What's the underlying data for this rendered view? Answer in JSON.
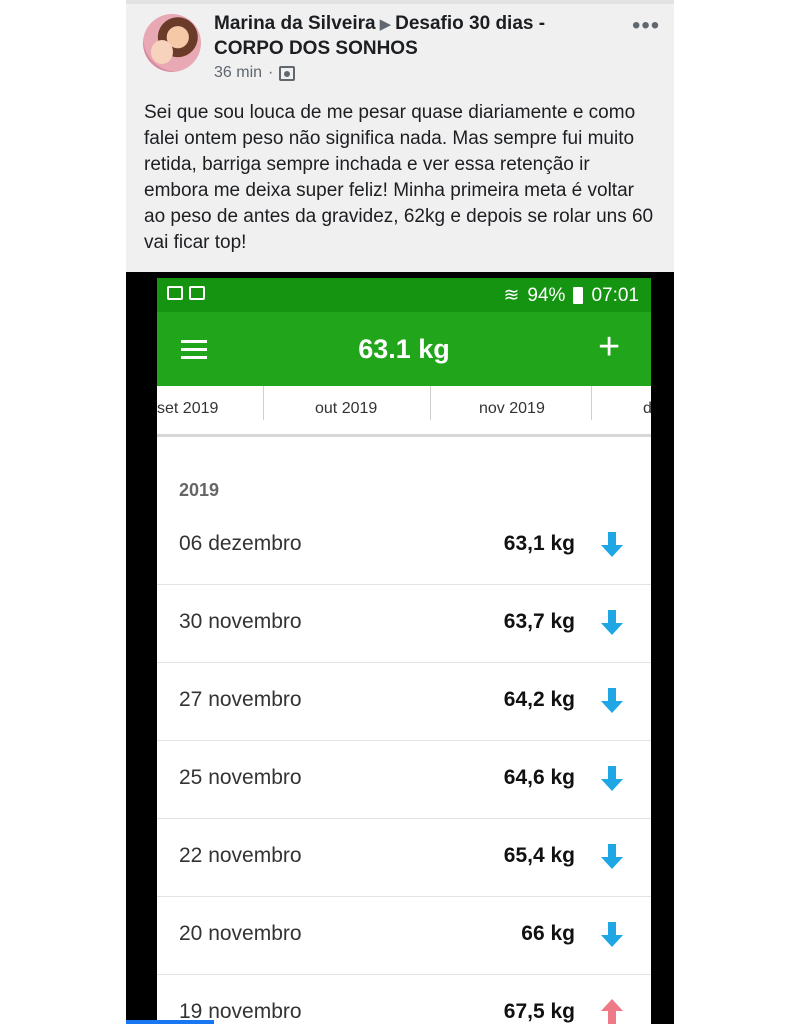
{
  "post": {
    "author": "Marina da Silveira",
    "group": "Desafio 30 dias - CORPO DOS SONHOS",
    "time": "36 min",
    "separator": "·",
    "more_label": "•••",
    "text": "Sei que sou louca de me pesar quase diariamente e como falei ontem peso não significa nada. Mas sempre fui muito retida, barriga sempre inchada e ver essa retenção ir embora me deixa super feliz! Minha primeira meta é voltar ao peso de antes da gravidez, 62kg e depois se rolar uns 60 vai ficar top!"
  },
  "phone": {
    "status": {
      "battery": "94%",
      "time": "07:01"
    },
    "appbar": {
      "title": "63.1 kg",
      "add_label": "+"
    },
    "tabs": [
      "set 2019",
      "out 2019",
      "nov 2019",
      "d"
    ],
    "year": "2019",
    "entries": [
      {
        "date": "06 dezembro",
        "weight": "63,1 kg",
        "trend": "down"
      },
      {
        "date": "30 novembro",
        "weight": "63,7 kg",
        "trend": "down"
      },
      {
        "date": "27 novembro",
        "weight": "64,2 kg",
        "trend": "down"
      },
      {
        "date": "25 novembro",
        "weight": "64,6 kg",
        "trend": "down"
      },
      {
        "date": "22 novembro",
        "weight": "65,4 kg",
        "trend": "down"
      },
      {
        "date": "20 novembro",
        "weight": "66 kg",
        "trend": "down"
      },
      {
        "date": "19 novembro",
        "weight": "67,5 kg",
        "trend": "up"
      }
    ],
    "colors": {
      "down": "#1ea7e4",
      "up": "#ef7a87",
      "appbar": "#21a51a",
      "statusbar": "#159411"
    }
  }
}
